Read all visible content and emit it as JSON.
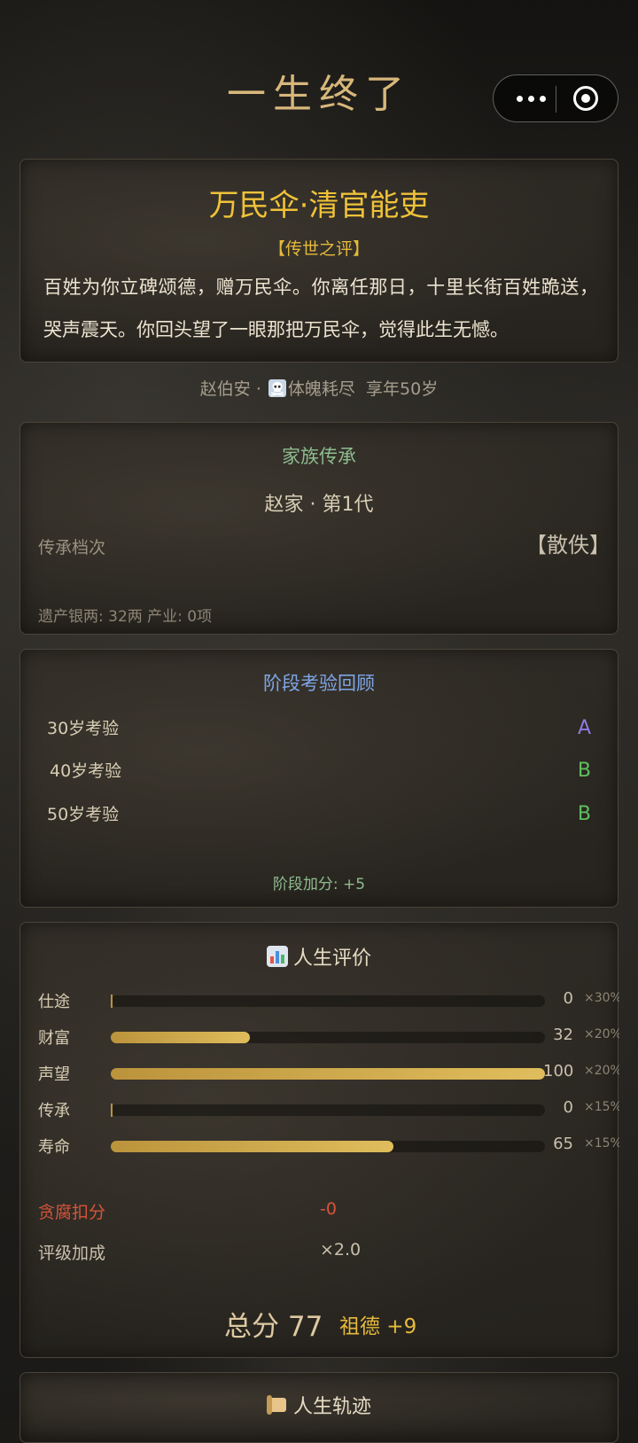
{
  "header": {
    "title": "一生终了"
  },
  "capsule": {
    "more_icon": "more-dots-icon",
    "close_icon": "target-close-icon"
  },
  "verdict": {
    "title": "万民伞·清官能吏",
    "tag": "【传世之评】",
    "desc": "百姓为你立碑颂德，赠万民伞。你离任那日，十里长街百姓跪送，哭声震天。你回头望了一眼那把万民伞，觉得此生无憾。"
  },
  "death": {
    "name": "赵伯安",
    "sep": " · ",
    "cause": "体魄耗尽",
    "age": "享年50岁"
  },
  "family": {
    "heading": "家族传承",
    "generation": "赵家 · 第1代",
    "tier_label": "传承档次",
    "tier_value": "【散佚】",
    "assets": "遗产银两: 32两   产业: 0项"
  },
  "exams": {
    "heading": "阶段考验回顾",
    "items": [
      {
        "name": "30岁考验",
        "grade": "A",
        "color": "#8d7be0"
      },
      {
        "name": "40岁考验",
        "grade": "B",
        "color": "#5fbf5f"
      },
      {
        "name": "50岁考验",
        "grade": "B",
        "color": "#5fbf5f"
      }
    ],
    "bonus": "阶段加分: +5"
  },
  "evaluation": {
    "heading": "人生评价",
    "icon": "bar-chart-icon",
    "scores": [
      {
        "label": "仕途",
        "value": 0,
        "display": "0",
        "weight": "×30%"
      },
      {
        "label": "财富",
        "value": 32,
        "display": "32",
        "weight": "×20%"
      },
      {
        "label": "声望",
        "value": 100,
        "display": "100",
        "weight": "×20%"
      },
      {
        "label": "传承",
        "value": 0,
        "display": "0",
        "weight": "×15%"
      },
      {
        "label": "寿命",
        "value": 65,
        "display": "65",
        "weight": "×15%"
      }
    ],
    "max": 100,
    "corruption_label": "贪腐扣分",
    "corruption_value": "-0",
    "multiplier_label": "评级加成",
    "multiplier_value": "×2.0",
    "total": "总分 77",
    "ancestor": "祖德 +9"
  },
  "trajectory": {
    "heading": "人生轨迹",
    "icon": "scroll-icon"
  },
  "colors": {
    "gold": "#f0c239",
    "bar": "#d4ad4e",
    "green": "#8fbd8f",
    "blue": "#7ea6e8",
    "red": "#d5553b"
  }
}
